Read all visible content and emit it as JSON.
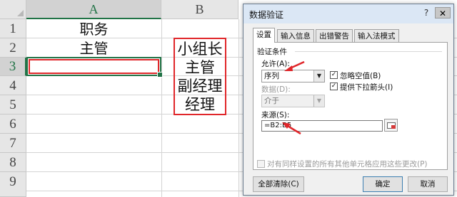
{
  "sheet": {
    "columns": [
      "A",
      "B"
    ],
    "rows": [
      "1",
      "2",
      "3",
      "4",
      "5",
      "6",
      "7",
      "8",
      "9"
    ],
    "selected_column": "A",
    "selected_row": "3",
    "cells": {
      "A1": "职务",
      "A2": "主管",
      "B_list": [
        "小组长",
        "主管",
        "副经理",
        "经理"
      ]
    }
  },
  "dialog": {
    "title": "数据验证",
    "help": "?",
    "close": "✕",
    "tabs": [
      "设置",
      "输入信息",
      "出错警告",
      "输入法模式"
    ],
    "active_tab": "设置",
    "criteria_label": "验证条件",
    "allow_label": "允许(A):",
    "allow_value": "序列",
    "ignore_blank_label": "忽略空值(B)",
    "ignore_blank_checked": true,
    "dropdown_label": "提供下拉箭头(I)",
    "dropdown_checked": true,
    "data_label": "数据(D):",
    "data_value": "介于",
    "source_label": "来源(S):",
    "source_value": "=B2:B5",
    "apply_all_label": "对有同样设置的所有其他单元格应用这些更改(P)",
    "apply_all_checked": false,
    "clear_all_button": "全部清除(C)",
    "ok_button": "确定",
    "cancel_button": "取消",
    "check_mark": "✓",
    "dropdown_glyph": "▼"
  },
  "colors": {
    "annotation_red": "#e0262a",
    "excel_green": "#217346"
  }
}
